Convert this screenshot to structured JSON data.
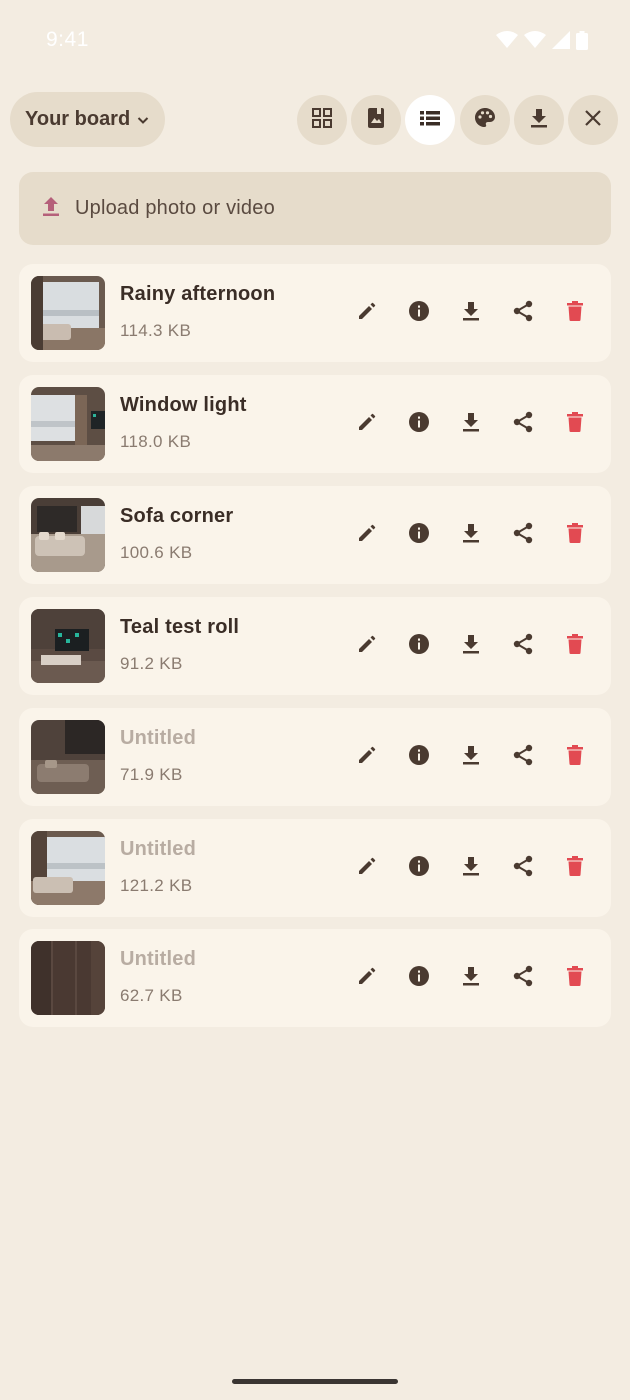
{
  "status_bar": {
    "time": "9:41"
  },
  "toolbar": {
    "board_label": "Your board",
    "buttons": [
      "grid-view",
      "board-view",
      "list-view",
      "palette",
      "download",
      "close"
    ],
    "active": "list-view"
  },
  "upload": {
    "label": "Upload photo or video"
  },
  "items": [
    {
      "title": "Rainy afternoon",
      "size": "114.3 KB",
      "untitled": false
    },
    {
      "title": "Window light",
      "size": "118.0 KB",
      "untitled": false
    },
    {
      "title": "Sofa corner",
      "size": "100.6 KB",
      "untitled": false
    },
    {
      "title": "Teal test roll",
      "size": "91.2 KB",
      "untitled": false
    },
    {
      "title": "Untitled",
      "size": "71.9 KB",
      "untitled": true
    },
    {
      "title": "Untitled",
      "size": "121.2 KB",
      "untitled": true
    },
    {
      "title": "Untitled",
      "size": "62.7 KB",
      "untitled": true
    }
  ],
  "colors": {
    "background": "#f3ece1",
    "chip": "#e6dccb",
    "card": "#faf4ea",
    "delete": "#e24a52",
    "upload_icon": "#b5607a"
  }
}
